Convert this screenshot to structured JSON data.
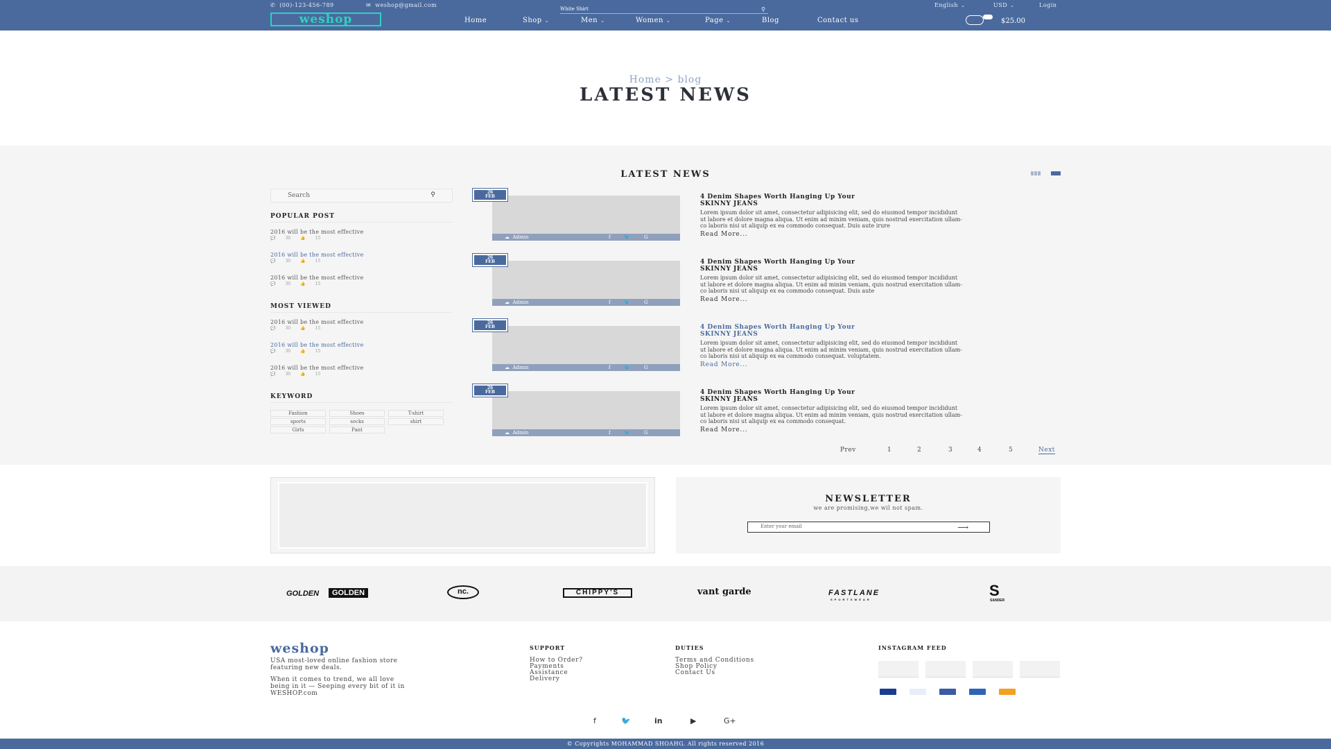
{
  "topbar": {
    "phone": "(00)-123-456-789",
    "email": "weshop@gmail.com",
    "search_value": "White Shirt",
    "language": "English",
    "currency": "USD",
    "login": "Login"
  },
  "header": {
    "logo": "weshop",
    "nav": [
      "Home",
      "Shop",
      "Men",
      "Women",
      "Page",
      "Blog",
      "Contact us"
    ],
    "cart_price": "$25.00"
  },
  "hero": {
    "breadcrumb": "Home > blog",
    "title": "LATEST NEWS"
  },
  "main": {
    "section_title": "LATEST NEWS"
  },
  "sidebar": {
    "search_placeholder": "Search",
    "popular_heading": "POPULAR POST",
    "popular": [
      {
        "title": "2016 will be the most effective",
        "comments": "30",
        "likes": "15"
      },
      {
        "title": "2016 will be the most effective",
        "comments": "30",
        "likes": "15"
      },
      {
        "title": "2016 will be the most effective",
        "comments": "30",
        "likes": "15"
      }
    ],
    "viewed_heading": "MOST VIEWED",
    "viewed": [
      {
        "title": "2016 will be the most effective",
        "comments": "30",
        "likes": "15"
      },
      {
        "title": "2016 will be the most effective",
        "comments": "30",
        "likes": "15"
      },
      {
        "title": "2016 will be the most effective",
        "comments": "30",
        "likes": "15"
      }
    ],
    "keyword_heading": "KEYWORD",
    "keywords": [
      "Fashion",
      "Shoes",
      "T-shirt",
      "sports",
      "socks",
      "shirt",
      "Girls",
      "Pant"
    ]
  },
  "posts": [
    {
      "day": "26",
      "month": "FEB",
      "author": "Admin",
      "title1": "4 Denim Shapes Worth Hanging Up Your",
      "title2": "SKINNY JEANS",
      "text": [
        "Lorem ipsum dolor sit amet, consectetur adipisicing elit, sed do eiusmod tempor incididunt",
        "ut labore et dolore magna aliqua. Ut enim ad minim veniam, quis nostrud exercitation ullam-",
        "co laboris nisi ut aliquip ex ea commodo consequat. Duis aute irure"
      ],
      "read_more": "Read More..."
    },
    {
      "day": "26",
      "month": "FEB",
      "author": "Admin",
      "title1": "4 Denim Shapes Worth Hanging Up Your",
      "title2": "SKINNY JEANS",
      "text": [
        "Lorem ipsum dolor sit amet, consectetur adipisicing elit, sed do eiusmod tempor incididunt",
        "ut labore et dolore magna aliqua. Ut enim ad minim veniam, quis nostrud exercitation ullam-",
        "co laboris nisi ut aliquip ex ea commodo consequat. Duis aute"
      ],
      "read_more": "Read More..."
    },
    {
      "day": "26",
      "month": "FEB",
      "author": "Admin",
      "title1": "4 Denim Shapes Worth Hanging Up Your",
      "title2": "SKINNY JEANS",
      "text": [
        "Lorem ipsum dolor sit amet, consectetur adipisicing elit, sed do eiusmod tempor incididunt",
        "ut labore et dolore magna aliqua. Ut enim ad minim veniam, quis nostrud exercitation ullam-",
        "co laboris nisi ut aliquip ex ea commodo consequat. voluptatem."
      ],
      "read_more": "Read More..."
    },
    {
      "day": "26",
      "month": "FEB",
      "author": "Admin",
      "title1": "4 Denim Shapes Worth Hanging Up Your",
      "title2": "SKINNY JEANS",
      "text": [
        "Lorem ipsum dolor sit amet, consectetur adipisicing elit, sed do eiusmod tempor incididunt",
        "ut labore et dolore magna aliqua. Ut enim ad minim veniam, quis nostrud exercitation ullam-",
        "co laboris nisi ut aliquip ex ea commodo consequat."
      ],
      "read_more": "Read More..."
    }
  ],
  "pagination": {
    "prev": "Prev",
    "pages": [
      "1",
      "2",
      "3",
      "4",
      "5"
    ],
    "next": "Next"
  },
  "newsletter": {
    "title": "NEWSLETTER",
    "subtitle": "we are promising,we wil not spam.",
    "placeholder": "Enter your email"
  },
  "brands": [
    "GOLDEN",
    "GOLDEN",
    "nc.",
    "CHIPPY'S",
    "vant garde",
    "FASTLANE",
    "SPORTSWEAR",
    "SANDER"
  ],
  "footer": {
    "logo": "weshop",
    "about1": [
      "USA most-loved online fashion store",
      "featuring new deals."
    ],
    "about2": [
      "When it comes to trend, we all love",
      "being in it — Seeping every bit of it in",
      "WESHOP.com"
    ],
    "support_heading": "SUPPORT",
    "support": [
      "How to Order?",
      "Payments",
      "Assistance",
      "Delivery"
    ],
    "duties_heading": "DUTIES",
    "duties": [
      "Terms and Conditions",
      "Shop Policy",
      "Contact Us"
    ],
    "instagram_heading": "INSTAGRAM FEED",
    "copyright": "© Copyrights MOHAMMAD SHOAHG. All rights reserved 2016"
  },
  "colors": {
    "primary": "#4a6a9e",
    "accent": "#2dd3c0",
    "grey_bg": "#f5f5f5"
  }
}
